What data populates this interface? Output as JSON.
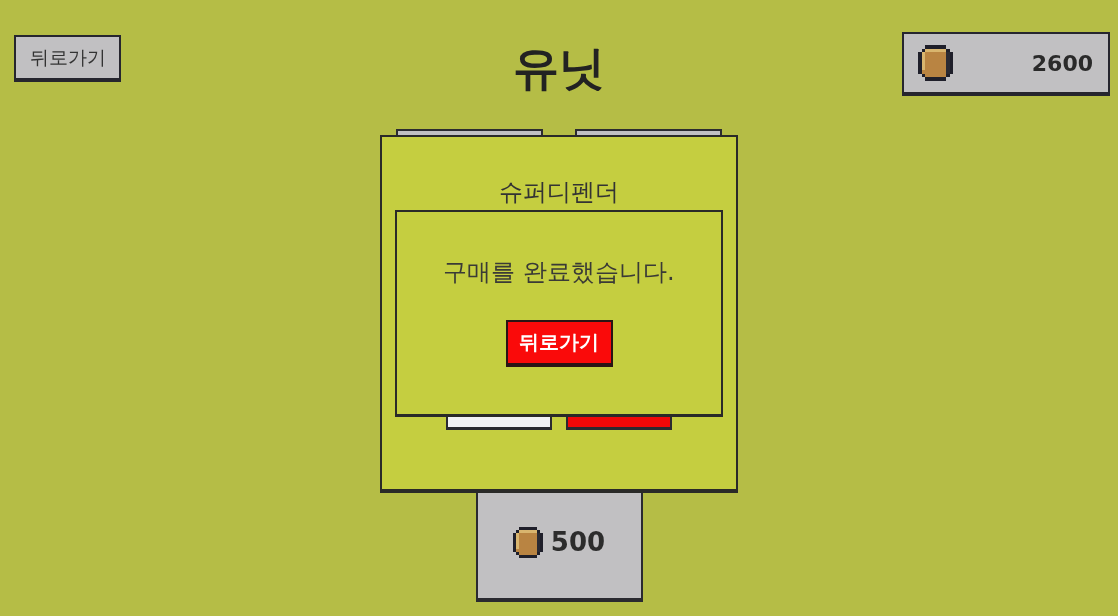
{
  "back_button": {
    "label": "뒤로가기"
  },
  "title": "유닛",
  "coins": {
    "amount": "2600"
  },
  "unit_card": {
    "name": "슈퍼디펜더",
    "price": "500"
  },
  "dialog": {
    "message": "구매를 완료했습니다.",
    "button": "뒤로가기"
  }
}
